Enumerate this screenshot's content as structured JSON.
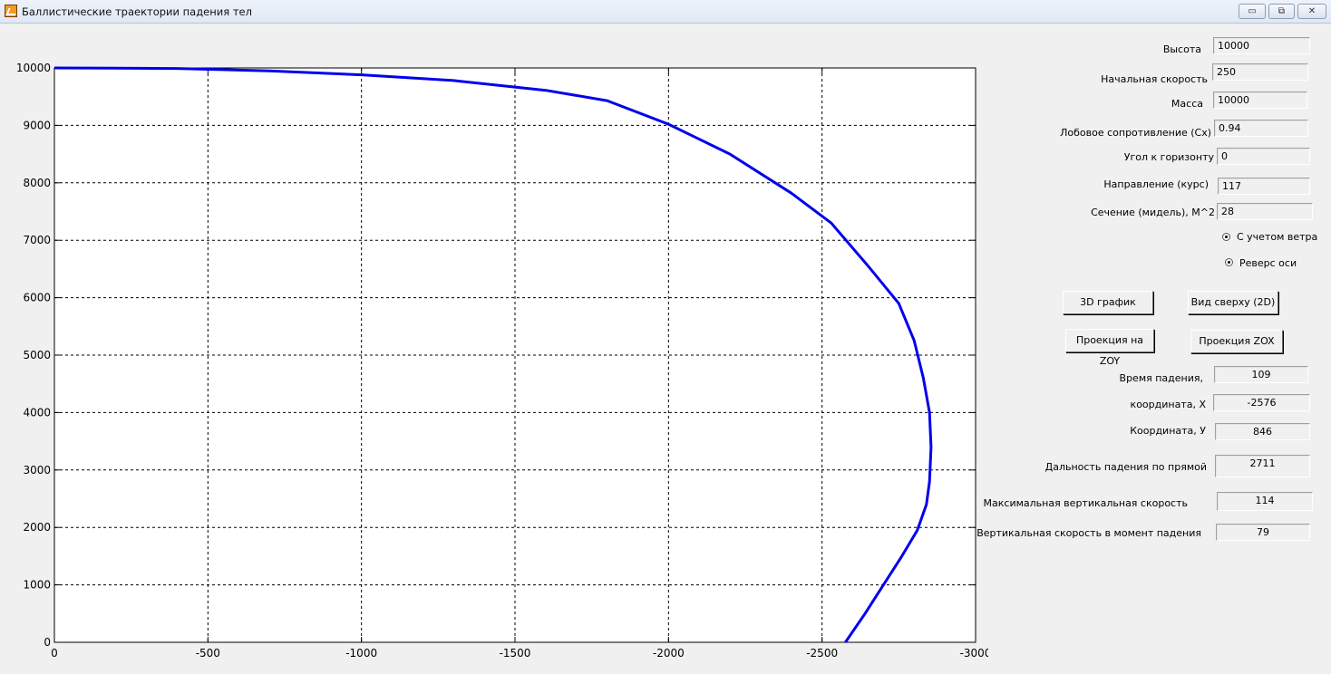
{
  "window": {
    "title": "Баллистические траектории падения тел",
    "minimize": "▭",
    "maximize": "⧉",
    "close": "✕"
  },
  "params": [
    {
      "label": "Высота",
      "value": "10000"
    },
    {
      "label": "Начальная скорость",
      "value": "250"
    },
    {
      "label": "Масса",
      "value": "10000"
    },
    {
      "label": "Лобовое сопротивление (Cx)",
      "value": "0.94"
    },
    {
      "label": "Угол к горизонту",
      "value": "0"
    },
    {
      "label": "Направление  (курс)",
      "value": "117"
    },
    {
      "label": "Сечение (мидель), M^2",
      "value": "28"
    }
  ],
  "options": [
    {
      "label": "С учетом ветра",
      "checked": true
    },
    {
      "label": "Реверс оси",
      "checked": true
    }
  ],
  "buttons": {
    "plot3d": "3D график",
    "top_view": "Вид сверху (2D)",
    "proj_zoy": "Проекция на ZOY",
    "proj_zox": "Проекция ZOX"
  },
  "results": [
    {
      "label": "Время падения,",
      "value": "109"
    },
    {
      "label": "координата, X",
      "value": "-2576"
    },
    {
      "label": "Координата, У",
      "value": "846"
    },
    {
      "label": "Дальность падения по прямой",
      "value": "2711"
    },
    {
      "label": "Максимальная вертикальная скорость",
      "value": "114"
    },
    {
      "label": "Вертикальная  скорость в момент падения",
      "value": "79"
    }
  ],
  "chart_data": {
    "type": "line",
    "xlim": [
      0,
      -3000
    ],
    "ylim": [
      0,
      10000
    ],
    "x_ticks": [
      0,
      -500,
      -1000,
      -1500,
      -2000,
      -2500,
      -3000
    ],
    "y_ticks": [
      0,
      1000,
      2000,
      3000,
      4000,
      5000,
      6000,
      7000,
      8000,
      9000,
      10000
    ],
    "grid": true,
    "line_color": "#0000ee",
    "series": [
      {
        "x": [
          0,
          -400,
          -700,
          -1000,
          -1300,
          -1600,
          -1800,
          -2000,
          -2200,
          -2400,
          -2530,
          -2650,
          -2750,
          -2800,
          -2830,
          -2850,
          -2855,
          -2850,
          -2840,
          -2810,
          -2760,
          -2700,
          -2640,
          -2576
        ],
        "y": [
          10000,
          9990,
          9950,
          9880,
          9780,
          9610,
          9430,
          9020,
          8500,
          7820,
          7300,
          6550,
          5900,
          5250,
          4600,
          4000,
          3400,
          2800,
          2400,
          1950,
          1500,
          1000,
          500,
          0
        ]
      }
    ]
  }
}
